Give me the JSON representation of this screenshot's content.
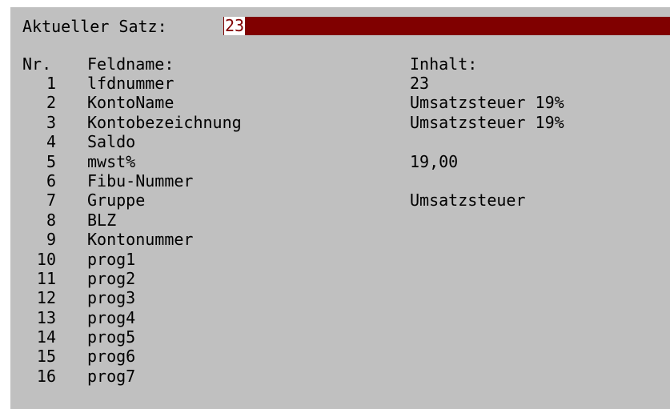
{
  "header": {
    "label": "Aktueller Satz:",
    "record": "23"
  },
  "columns": {
    "nr": "Nr.",
    "name": "Feldname:",
    "content": "Inhalt:"
  },
  "colors": {
    "background": "#c0c0c0",
    "record_bar": "#800000",
    "text": "#000000"
  },
  "fields": [
    {
      "nr": "1",
      "name": "lfdnummer",
      "value": "23"
    },
    {
      "nr": "2",
      "name": "KontoName",
      "value": "Umsatzsteuer 19%"
    },
    {
      "nr": "3",
      "name": "Kontobezeichnung",
      "value": "Umsatzsteuer 19%"
    },
    {
      "nr": "4",
      "name": "Saldo",
      "value": ""
    },
    {
      "nr": "5",
      "name": "mwst%",
      "value": "19,00"
    },
    {
      "nr": "6",
      "name": "Fibu-Nummer",
      "value": ""
    },
    {
      "nr": "7",
      "name": "Gruppe",
      "value": "Umsatzsteuer"
    },
    {
      "nr": "8",
      "name": "BLZ",
      "value": ""
    },
    {
      "nr": "9",
      "name": "Kontonummer",
      "value": ""
    },
    {
      "nr": "10",
      "name": "prog1",
      "value": ""
    },
    {
      "nr": "11",
      "name": "prog2",
      "value": ""
    },
    {
      "nr": "12",
      "name": "prog3",
      "value": ""
    },
    {
      "nr": "13",
      "name": "prog4",
      "value": ""
    },
    {
      "nr": "14",
      "name": "prog5",
      "value": ""
    },
    {
      "nr": "15",
      "name": "prog6",
      "value": ""
    },
    {
      "nr": "16",
      "name": "prog7",
      "value": ""
    }
  ]
}
